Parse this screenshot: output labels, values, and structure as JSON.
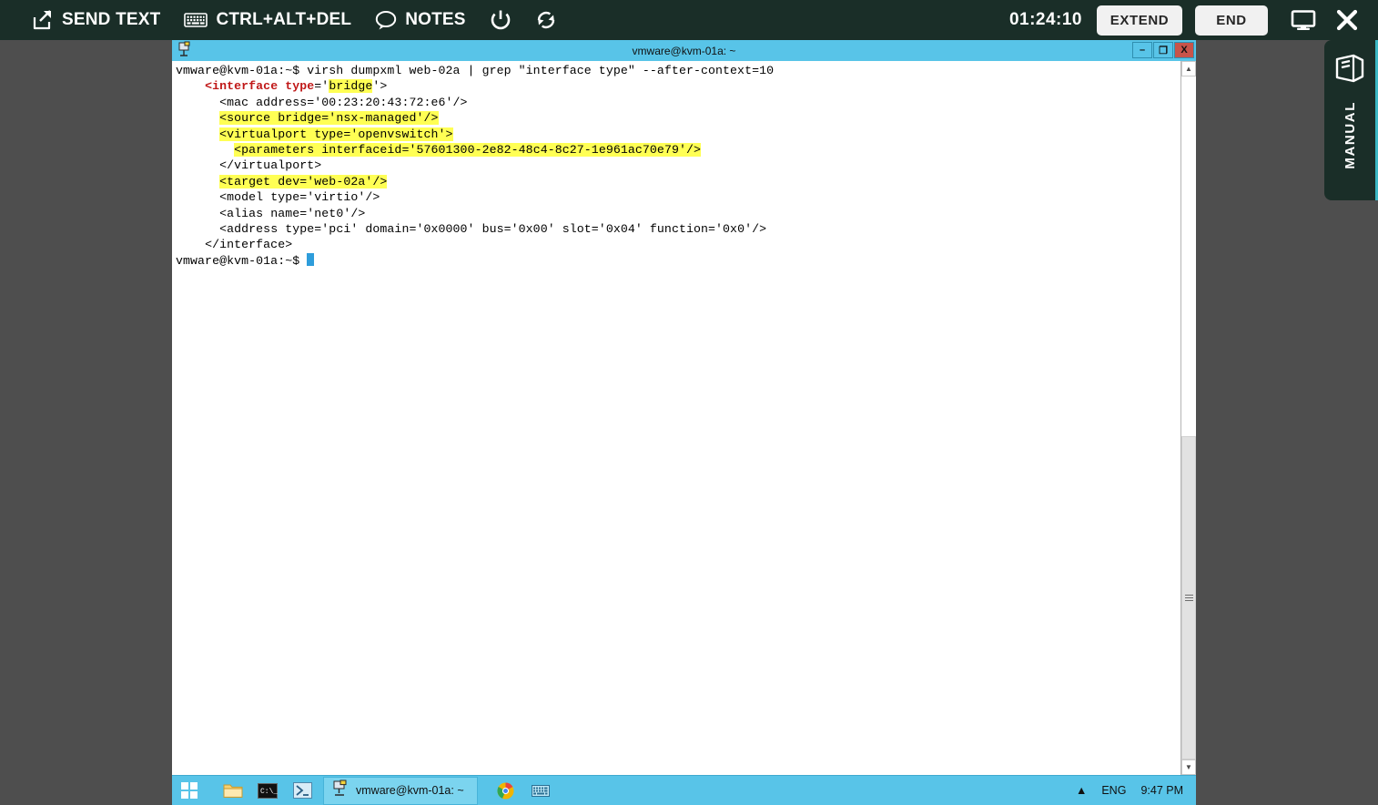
{
  "toolbar": {
    "send_text": "SEND TEXT",
    "ctrl_alt_del": "CTRL+ALT+DEL",
    "notes": "NOTES",
    "power_icon": "power-icon",
    "refresh_icon": "refresh-icon",
    "timer": "01:24:10",
    "extend": "EXTEND",
    "end": "END",
    "monitor_icon": "monitor-icon",
    "close_icon": "close-icon",
    "background_color": "#1a2e28"
  },
  "manual_tab": {
    "label": "MANUAL",
    "icon": "book-icon",
    "accent_color": "#3bb7c4"
  },
  "window": {
    "title": "vmware@kvm-01a: ~",
    "icon": "terminal-icon",
    "titlebar_color": "#58c4e8",
    "minimize": "–",
    "maximize": "❐",
    "close": "X"
  },
  "terminal": {
    "prompt": "vmware@kvm-01a:~$",
    "command": "virsh dumpxml web-02a | grep \"interface type\" --after-context=10",
    "highlight_color": "#ffff54",
    "match_color": "#c01818",
    "lines": [
      {
        "indent": 4,
        "segments": [
          {
            "t": "<",
            "s": "match"
          },
          {
            "t": "interface",
            "s": "match"
          },
          {
            "t": " ",
            "s": "plain"
          },
          {
            "t": "type",
            "s": "match"
          },
          {
            "t": "='",
            "s": "plain"
          },
          {
            "t": "bridge",
            "s": "hl"
          },
          {
            "t": "'>",
            "s": "plain"
          }
        ]
      },
      {
        "indent": 6,
        "segments": [
          {
            "t": "<mac address='00:23:20:43:72:e6'/>",
            "s": "plain"
          }
        ]
      },
      {
        "indent": 6,
        "segments": [
          {
            "t": "<source bridge='nsx-managed'/>",
            "s": "hl"
          }
        ]
      },
      {
        "indent": 6,
        "segments": [
          {
            "t": "<virtualport type='openvswitch'>",
            "s": "hl"
          }
        ]
      },
      {
        "indent": 8,
        "segments": [
          {
            "t": "<parameters interfaceid='57601300-2e82-48c4-8c27-1e961ac70e79'/>",
            "s": "hl"
          }
        ]
      },
      {
        "indent": 6,
        "segments": [
          {
            "t": "</virtualport>",
            "s": "plain"
          }
        ]
      },
      {
        "indent": 6,
        "segments": [
          {
            "t": "<target dev='web-02a'/>",
            "s": "hl"
          }
        ]
      },
      {
        "indent": 6,
        "segments": [
          {
            "t": "<model type='virtio'/>",
            "s": "plain"
          }
        ]
      },
      {
        "indent": 6,
        "segments": [
          {
            "t": "<alias name='net0'/>",
            "s": "plain"
          }
        ]
      },
      {
        "indent": 6,
        "segments": [
          {
            "t": "<address type='pci' domain='0x0000' bus='0x00' slot='0x04' function='0x0'/>",
            "s": "plain"
          }
        ]
      },
      {
        "indent": 4,
        "segments": [
          {
            "t": "</interface>",
            "s": "plain"
          }
        ]
      }
    ],
    "final_prompt": "vmware@kvm-01a:~$"
  },
  "taskbar": {
    "start_icon": "windows-start-icon",
    "icons": [
      "file-explorer-icon",
      "command-prompt-icon",
      "powershell-icon"
    ],
    "active_window": {
      "icon": "putty-icon",
      "label": "vmware@kvm-01a: ~"
    },
    "pinned": [
      "chrome-icon",
      "keyboard-icon"
    ],
    "tray": {
      "chevron": "show-hidden-icons",
      "language": "ENG",
      "clock": "9:47 PM"
    },
    "color": "#58c4e8"
  }
}
